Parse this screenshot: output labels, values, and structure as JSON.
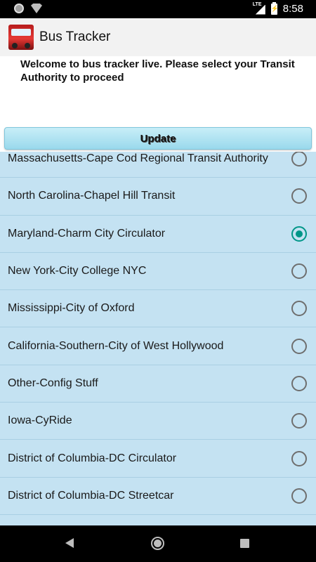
{
  "status_bar": {
    "time": "8:58",
    "network_label": "LTE",
    "icons": [
      "notification-circle-icon",
      "wifi-icon",
      "lte-signal-icon",
      "battery-charging-icon"
    ]
  },
  "app_bar": {
    "title": "Bus Tracker",
    "icon": "bus-icon"
  },
  "welcome_text": "Welcome to bus tracker live. Please select your Transit Authority to proceed",
  "update_button_label": "Update",
  "transit_list": [
    {
      "label": "Massachusetts-Cape Cod Regional Transit Authority",
      "selected": false
    },
    {
      "label": "North Carolina-Chapel Hill Transit",
      "selected": false
    },
    {
      "label": "Maryland-Charm City Circulator",
      "selected": true
    },
    {
      "label": "New York-City College NYC",
      "selected": false
    },
    {
      "label": "Mississippi-City of Oxford",
      "selected": false
    },
    {
      "label": "California-Southern-City of West Hollywood",
      "selected": false
    },
    {
      "label": "Other-Config Stuff",
      "selected": false
    },
    {
      "label": "Iowa-CyRide",
      "selected": false
    },
    {
      "label": "District of Columbia-DC Circulator",
      "selected": false
    },
    {
      "label": "District of Columbia-DC Streetcar",
      "selected": false
    }
  ],
  "nav_bar": {
    "icons": [
      "back-icon",
      "home-icon",
      "recents-icon"
    ]
  },
  "colors": {
    "list_background": "#c4e2f2",
    "radio_selected": "#009688",
    "button_background": "#9ad9ec"
  }
}
